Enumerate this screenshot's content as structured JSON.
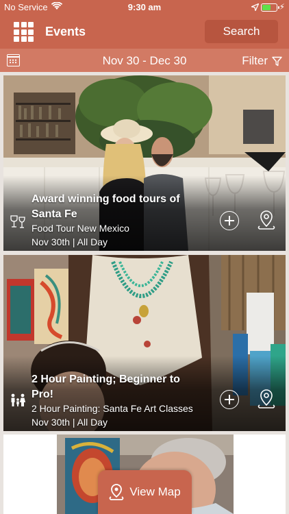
{
  "status_bar": {
    "carrier": "No Service",
    "time": "9:30 am",
    "battery_level": 0.6,
    "battery_color": "#5ee04a"
  },
  "header": {
    "title": "Events",
    "search_label": "Search",
    "menu_icon": "grid-icon"
  },
  "date_bar": {
    "range": "Nov 30  -  Dec 30",
    "filter_label": "Filter",
    "calendar_icon": "calendar-icon",
    "filter_icon": "funnel-icon"
  },
  "events": [
    {
      "title": "Award winning food tours of Santa Fe",
      "subtitle": "Food Tour New Mexico",
      "when": "Nov 30th | All Day",
      "category_icon": "food-drink-icon"
    },
    {
      "title": "2 Hour Painting; Beginner to Pro!",
      "subtitle": "2 Hour Painting: Santa Fe Art Classes",
      "when": "Nov 30th | All Day",
      "category_icon": "family-icon"
    },
    {
      "title": "",
      "subtitle": "",
      "when": "",
      "category_icon": ""
    }
  ],
  "footer": {
    "view_map_label": "View Map",
    "view_map_icon": "map-pin-icon"
  },
  "colors": {
    "primary": "#c8654e",
    "date_bar": "#d27a64",
    "search_button": "#b7553f"
  }
}
